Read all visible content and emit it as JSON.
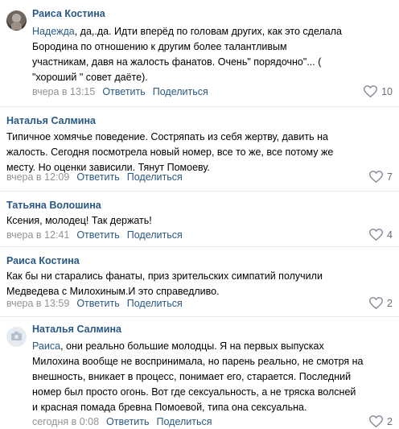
{
  "comments": [
    {
      "author": "Раиса Костина",
      "mention": "Надежда",
      "lines": [
        ", да,.да. Идти вперёд по головам других, как это сделала",
        "Бородина по отношению к другим более талантливым",
        "участникам, давя на жалость фанатов. Очень\" порядочно\"... (",
        "\"хороший \" совет даёте)."
      ],
      "time": "вчера в 13:15",
      "reply": "Ответить",
      "share": "Поделиться",
      "likes": "10"
    },
    {
      "author": "Наталья Салмина",
      "lines": [
        "Типичное хомячье поведение. Состряпать из себя жертву, давить на",
        "жалость. Сегодня посмотрела новый номер, все то же, все потому же",
        "месту. Но оценки зависили. Тянут Помоеву."
      ],
      "time": "вчера в 12:09",
      "reply": "Ответить",
      "share": "Поделиться",
      "likes": "7"
    },
    {
      "author": "Татьяна Волошина",
      "lines": [
        "Ксения, молодец! Так держать!"
      ],
      "time": "вчера в 12:41",
      "reply": "Ответить",
      "share": "Поделиться",
      "likes": "4"
    },
    {
      "author": "Раиса Костина",
      "lines": [
        "Как бы ни старались фанаты, приз зрительских симпатий получили",
        "Медведева с Милохиным.И это справедливо."
      ],
      "time": "вчера в 13:59",
      "reply": "Ответить",
      "share": "Поделиться",
      "likes": "2"
    },
    {
      "author": "Наталья Салмина",
      "mention": "Раиса",
      "lines": [
        ", они реально большие молодцы. Я на первых выпусках",
        "Милохина вообще не воспринимала, но парень реально, не смотря на",
        "внешность, вникает в процесс, понимает его, старается. Последний",
        "номер был просто огонь. Вот где сексуальность, а не тряска волсней",
        "и красная помада бревна Помоевой, типа она сексуальна."
      ],
      "time": "сегодня в 0:08",
      "reply": "Ответить",
      "share": "Поделиться",
      "likes": "2"
    }
  ]
}
